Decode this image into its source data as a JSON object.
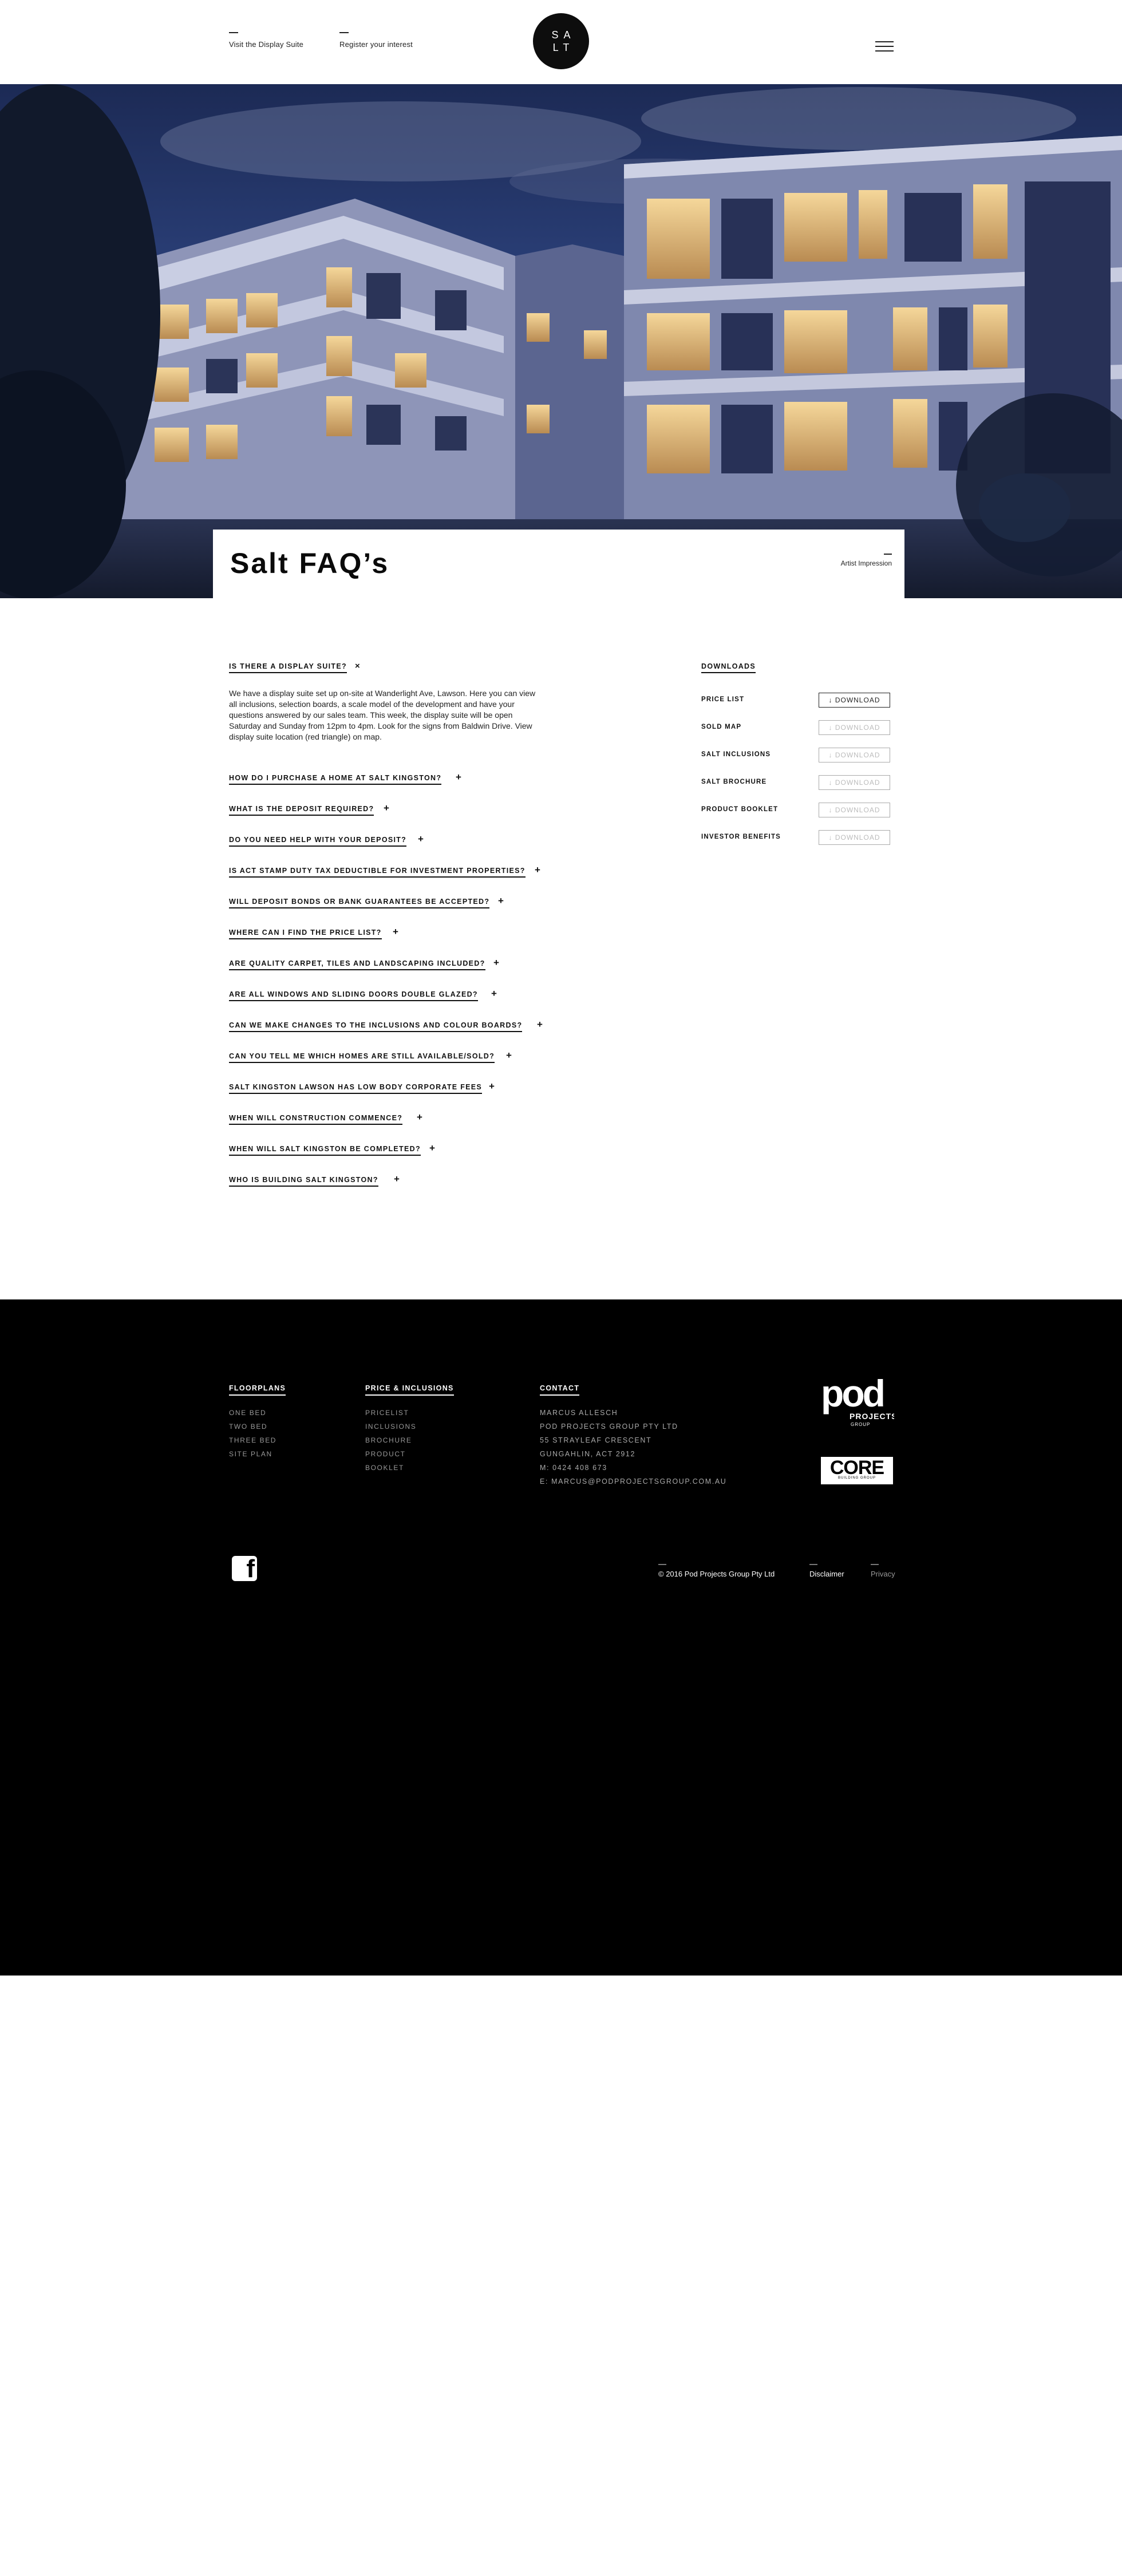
{
  "header": {
    "visit_link": "Visit the Display Suite",
    "register_link": "Register your  interest",
    "logo_line1": "SA",
    "logo_line2": "LT"
  },
  "hero": {
    "page_title": "Salt FAQ’s",
    "caption": "Artist Impression"
  },
  "faq": {
    "items": [
      {
        "question": "IS THERE A DISPLAY SUITE?",
        "toggle": "×",
        "answer": "We have a display suite set up on-site at Wanderlight Ave, Lawson. Here you can view all inclusions, selection boards, a scale model of the development and have your questions answered by our sales team. This week, the display suite will be open Saturday and Sunday from 12pm to 4pm. Look for the signs from Baldwin Drive. View display suite location (red triangle) on map."
      },
      {
        "question": "HOW DO I PURCHASE A HOME AT SALT KINGSTON?",
        "toggle": "+"
      },
      {
        "question": "WHAT IS THE DEPOSIT REQUIRED?",
        "toggle": "+"
      },
      {
        "question": "DO YOU NEED HELP WITH YOUR DEPOSIT?",
        "toggle": "+"
      },
      {
        "question": "IS ACT STAMP DUTY TAX DEDUCTIBLE FOR INVESTMENT PROPERTIES?",
        "toggle": "+"
      },
      {
        "question": "WILL DEPOSIT BONDS OR BANK GUARANTEES BE ACCEPTED?",
        "toggle": "+"
      },
      {
        "question": "WHERE CAN I FIND THE PRICE LIST?",
        "toggle": "+"
      },
      {
        "question": "ARE QUALITY CARPET, TILES AND LANDSCAPING INCLUDED?",
        "toggle": "+"
      },
      {
        "question": "ARE ALL WINDOWS AND SLIDING DOORS DOUBLE GLAZED?",
        "toggle": "+"
      },
      {
        "question": "CAN WE MAKE CHANGES TO THE INCLUSIONS AND COLOUR BOARDS?",
        "toggle": "+"
      },
      {
        "question": "CAN YOU TELL ME WHICH HOMES ARE STILL AVAILABLE/SOLD?",
        "toggle": "+"
      },
      {
        "question": "SALT KINGSTON LAWSON HAS LOW BODY CORPORATE FEES",
        "toggle": "+"
      },
      {
        "question": "WHEN WILL CONSTRUCTION COMMENCE?",
        "toggle": "+"
      },
      {
        "question": "WHEN WILL SALT KINGSTON BE COMPLETED?",
        "toggle": "+"
      },
      {
        "question": "WHO IS BUILDING SALT KINGSTON?",
        "toggle": "+"
      }
    ]
  },
  "downloads": {
    "heading": "DOWNLOADS",
    "button_label": "↓ DOWNLOAD",
    "items": [
      {
        "name": "PRICE LIST",
        "active": true
      },
      {
        "name": "SOLD MAP",
        "active": false
      },
      {
        "name": "SALT INCLUSIONS",
        "active": false
      },
      {
        "name": "SALT BROCHURE",
        "active": false
      },
      {
        "name": "PRODUCT BOOKLET",
        "active": false
      },
      {
        "name": "INVESTOR BENEFITS",
        "active": false
      }
    ]
  },
  "footer": {
    "floorplans": {
      "heading": "FLOORPLANS",
      "links": [
        "ONE BED",
        "TWO BED",
        "THREE BED",
        "SITE PLAN"
      ]
    },
    "price": {
      "heading": "PRICE & INCLUSIONS",
      "links": [
        "PRICELIST",
        "INCLUSIONS",
        "BROCHURE",
        "PRODUCT",
        "BOOKLET"
      ]
    },
    "contact": {
      "heading": "CONTACT",
      "lines": [
        "MARCUS ALLESCH",
        "POD PROJECTS GROUP PTY LTD",
        "55 STRAYLEAF CRESCENT",
        "GUNGAHLIN, ACT 2912",
        "M: 0424 408 673",
        "E: MARCUS@PODPROJECTSGROUP.COM.AU"
      ]
    },
    "pod_logo": {
      "word": "pod",
      "line2": "PROJECTS",
      "line3": "GROUP"
    },
    "core_logo": {
      "word": "CORE",
      "sub": "BUILDING GROUP"
    },
    "facebook_glyph": "f",
    "copyright": "© 2016 Pod Projects Group Pty Ltd",
    "disclaimer": "Disclaimer",
    "privacy": "Privacy"
  }
}
